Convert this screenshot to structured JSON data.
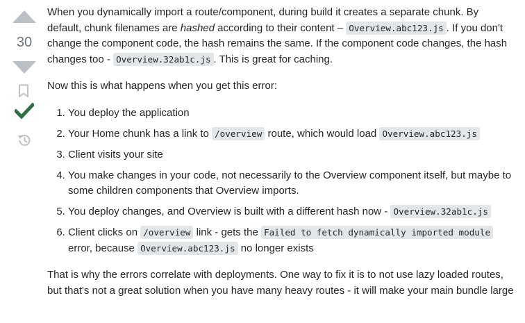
{
  "votes": {
    "count": "30"
  },
  "icons": {
    "upvote": "triangle-up-icon",
    "downvote": "triangle-down-icon",
    "bookmark": "bookmark-icon",
    "accepted": "checkmark-icon",
    "history": "history-icon"
  },
  "colors": {
    "vote_arrow": "#bbc0c4",
    "accepted": "#2f6f44",
    "code_bg": "#e3e6e8",
    "text": "#232629"
  },
  "post": {
    "p1": {
      "t1": "When you dynamically import a route/component, during build it creates a separate chunk. By default, chunk filenames are ",
      "em": "hashed",
      "t2": " according to their content – ",
      "c1": "Overview.abc123.js",
      "t3": ". If you don't change the component code, the hash remains the same. If the component code changes, the hash changes too - ",
      "c2": "Overview.32ab1c.js",
      "t4": ". This is great for caching."
    },
    "p2": "Now this is what happens when you get this error:",
    "list": {
      "i1": "You deploy the application",
      "i2": {
        "t1": "Your Home chunk has a link to ",
        "c1": "/overview",
        "t2": " route, which would load ",
        "c2": "Overview.abc123.js"
      },
      "i3": "Client visits your site",
      "i4": "You make changes in your code, not necessarily to the Overview component itself, but maybe to some children components that Overview imports.",
      "i5": {
        "t1": "You deploy changes, and Overview is built with a different hash now - ",
        "c1": "Overview.32ab1c.js"
      },
      "i6": {
        "t1": "Client clicks on ",
        "c1": "/overview",
        "t2": " link - gets the ",
        "c2": "Failed to fetch dynamically imported module",
        "t3": " error, because ",
        "c3": "Overview.abc123.js",
        "t4": " no longer exists"
      }
    },
    "p3": "That is why the errors correlate with deployments. One way to fix it is to not use lazy loaded routes, but that's not a great solution when you have many heavy routes - it will make your main bundle large"
  }
}
